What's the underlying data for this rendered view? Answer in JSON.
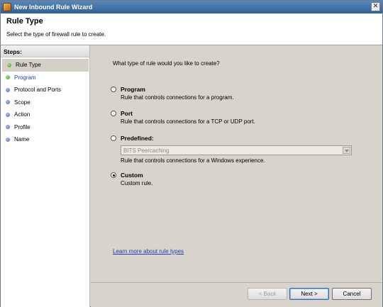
{
  "window": {
    "title": "New Inbound Rule Wizard",
    "close_glyph": "✕"
  },
  "header": {
    "title": "Rule Type",
    "subtitle": "Select the type of firewall rule to create."
  },
  "steps": {
    "heading": "Steps:",
    "items": [
      {
        "label": "Rule Type",
        "state": "current",
        "dot": "green"
      },
      {
        "label": "Program",
        "state": "link",
        "dot": "green"
      },
      {
        "label": "Protocol and Ports",
        "state": "pending",
        "dot": "blue"
      },
      {
        "label": "Scope",
        "state": "pending",
        "dot": "blue"
      },
      {
        "label": "Action",
        "state": "pending",
        "dot": "blue"
      },
      {
        "label": "Profile",
        "state": "pending",
        "dot": "blue"
      },
      {
        "label": "Name",
        "state": "pending",
        "dot": "blue"
      }
    ]
  },
  "main": {
    "question": "What type of rule would you like to create?",
    "options": [
      {
        "title": "Program",
        "description": "Rule that controls connections for a program.",
        "selected": false
      },
      {
        "title": "Port",
        "description": "Rule that controls connections for a TCP or UDP port.",
        "selected": false
      },
      {
        "title": "Predefined:",
        "description": "Rule that controls connections for a Windows experience.",
        "selected": false
      },
      {
        "title": "Custom",
        "description": "Custom rule.",
        "selected": true
      }
    ],
    "predefined_select": {
      "value": "BITS Peercaching",
      "enabled": false
    },
    "learn_more": "Learn more about rule types"
  },
  "footer": {
    "back_label": "< Back",
    "next_label": "Next >",
    "cancel_label": "Cancel"
  },
  "colors": {
    "titlebar": "#2f6095",
    "body_bg": "#d9d4cb",
    "link": "#1a3fb5"
  }
}
